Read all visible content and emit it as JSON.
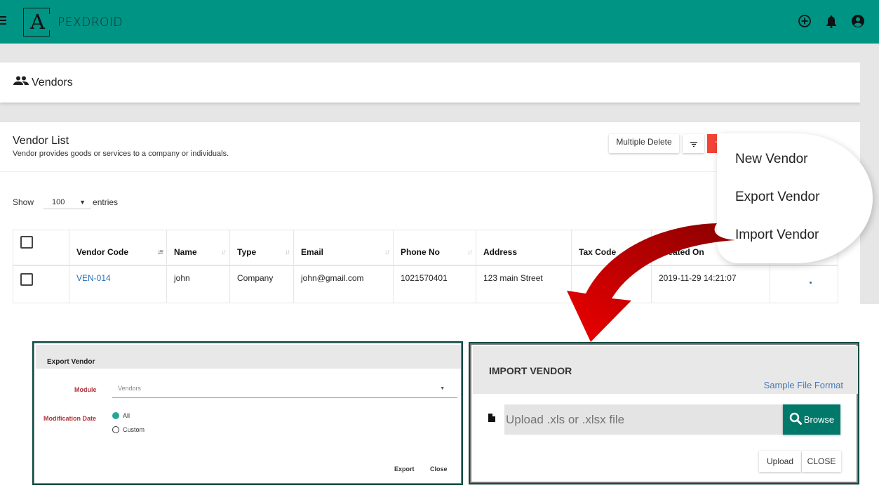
{
  "header": {
    "logo_letter": "A",
    "logo_text": "PEXDROID",
    "icons": [
      "add-circle-icon",
      "bell-icon",
      "account-circle-icon"
    ]
  },
  "page": {
    "title": "Vendors",
    "title_icon": "people-icon"
  },
  "vendor_list": {
    "title": "Vendor List",
    "subtitle": "Vendor provides goods or services to a company or individuals.",
    "buttons": {
      "multiple_delete": "Multiple Delete",
      "filter_icon": "filter-icon",
      "new": "+ New"
    },
    "show": {
      "prefix": "Show",
      "value": "100",
      "suffix": "entries"
    },
    "table": {
      "columns": [
        "Vendor Code",
        "Name",
        "Type",
        "Email",
        "Phone No",
        "Address",
        "Tax Code",
        "Created On"
      ],
      "rows": [
        {
          "vendor_code": "VEN-014",
          "name": "john",
          "type": "Company",
          "email": "john@gmail.com",
          "phone": "1021570401",
          "address": "123 main Street",
          "tax_code": "",
          "created_on": "2019-11-29 14:21:07"
        }
      ]
    }
  },
  "dropdown_menu": {
    "items": [
      "New Vendor",
      "Export Vendor",
      "Import Vendor"
    ]
  },
  "export_modal": {
    "title": "Export Vendor",
    "module_label": "Module",
    "module_value": "Vendors",
    "date_label": "Modification Date",
    "radio_options": [
      {
        "label": "All",
        "selected": true
      },
      {
        "label": "Custom",
        "selected": false
      }
    ],
    "export_button": "Export",
    "close_button": "Close"
  },
  "import_modal": {
    "title": "IMPORT VENDOR",
    "sample_link": "Sample File Format",
    "input_placeholder": "Upload .xls or .xlsx file",
    "browse_button": "Browse",
    "upload_button": "Upload",
    "close_button": "CLOSE"
  },
  "colors": {
    "header_bg": "#009485",
    "new_button": "#f44336",
    "browse_button": "#00796b",
    "label_red": "#b0303a",
    "link_blue": "#2a6db5",
    "arrow_red": "#cc0000"
  }
}
